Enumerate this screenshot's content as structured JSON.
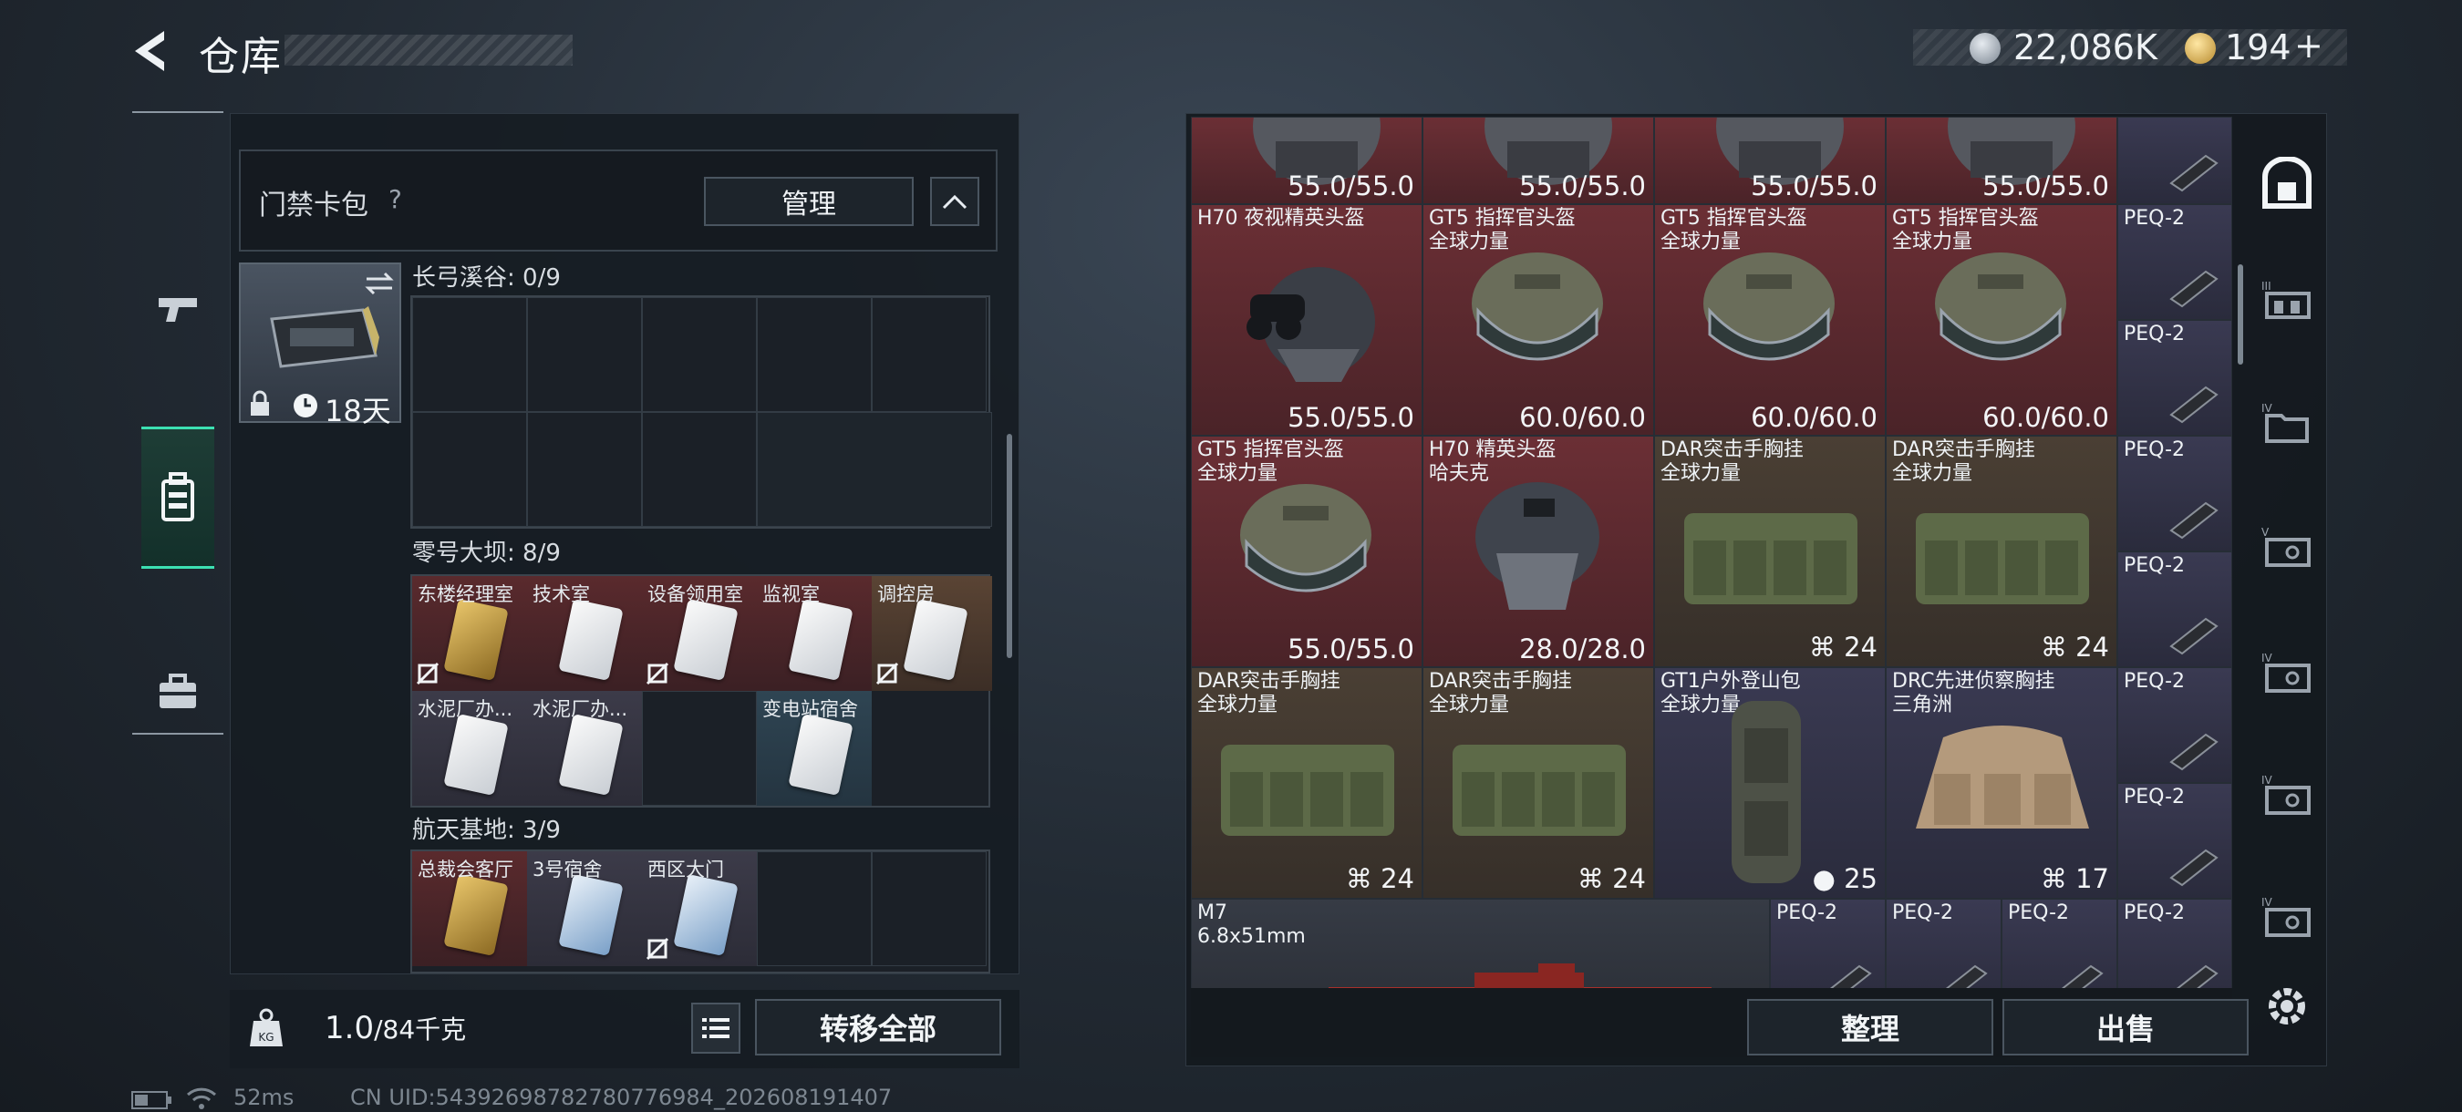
{
  "header": {
    "title": "仓库",
    "currency_silver": "22,086K",
    "currency_gold": "194",
    "add_label": "+"
  },
  "left_tabs": [
    "weapon-tab",
    "armor-tab",
    "keycard-tab",
    "briefcase-tab"
  ],
  "card_pack": {
    "title": "门禁卡包",
    "help": "?",
    "manage_label": "管理",
    "timer": "18天"
  },
  "sections": [
    {
      "label": "长弓溪谷: 0/9",
      "cards": []
    },
    {
      "label": "零号大坝: 8/9",
      "cards": [
        {
          "name": "东楼经理室"
        },
        {
          "name": "技术室"
        },
        {
          "name": "设备领用室"
        },
        {
          "name": "监视室"
        },
        {
          "name": "调控房"
        },
        {
          "name": "水泥厂办..."
        },
        {
          "name": "水泥厂办..."
        },
        {
          "name": "变电站宿舍"
        }
      ]
    },
    {
      "label": "航天基地: 3/9",
      "cards": [
        {
          "name": "总裁会客厅"
        },
        {
          "name": "3号宿舍"
        },
        {
          "name": "西区大门"
        }
      ]
    }
  ],
  "bottom_left": {
    "weight": "1.0",
    "weight_max": "/84千克",
    "transfer_all": "转移全部"
  },
  "status": {
    "ping": "52ms",
    "uid": "CN UID:54392698782780776984_202608191407"
  },
  "stash": {
    "row0": [
      {
        "durability": "55.0/55.0"
      },
      {
        "durability": "55.0/55.0"
      },
      {
        "durability": "55.0/55.0"
      },
      {
        "durability": "55.0/55.0"
      }
    ],
    "row1": [
      {
        "name": "H70 夜视精英头盔",
        "sub": "",
        "durability": "55.0/55.0"
      },
      {
        "name": "GT5 指挥官头盔",
        "sub": "全球力量",
        "durability": "60.0/60.0"
      },
      {
        "name": "GT5 指挥官头盔",
        "sub": "全球力量",
        "durability": "60.0/60.0"
      },
      {
        "name": "GT5 指挥官头盔",
        "sub": "全球力量",
        "durability": "60.0/60.0"
      }
    ],
    "row2": [
      {
        "name": "GT5 指挥官头盔",
        "sub": "全球力量",
        "durability": "55.0/55.0"
      },
      {
        "name": "H70 精英头盔",
        "sub": "哈夫克",
        "durability": "28.0/28.0"
      },
      {
        "name": "DAR突击手胸挂",
        "sub": "全球力量",
        "capacity": "24"
      },
      {
        "name": "DAR突击手胸挂",
        "sub": "全球力量",
        "capacity": "24"
      }
    ],
    "row3": [
      {
        "name": "DAR突击手胸挂",
        "sub": "全球力量",
        "capacity": "24"
      },
      {
        "name": "DAR突击手胸挂",
        "sub": "全球力量",
        "capacity": "24"
      },
      {
        "name": "GT1户外登山包",
        "sub": "全球力量",
        "capacity": "25"
      },
      {
        "name": "DRC先进侦察胸挂",
        "sub": "三角洲",
        "capacity": "17"
      }
    ],
    "peq_label": "PEQ-2",
    "weapon": {
      "name": "M7",
      "sub": "6.8x51mm"
    },
    "sort_label": "整理",
    "sell_label": "出售"
  },
  "right_tabs": [
    "safe-box-tab",
    "III",
    "IV",
    "IV",
    "V",
    "IV",
    "IV",
    "IV"
  ],
  "colors": {
    "accent": "#3ce0b2",
    "red_rarity": "#6b2f35",
    "purple_rarity": "#3a3a52"
  }
}
